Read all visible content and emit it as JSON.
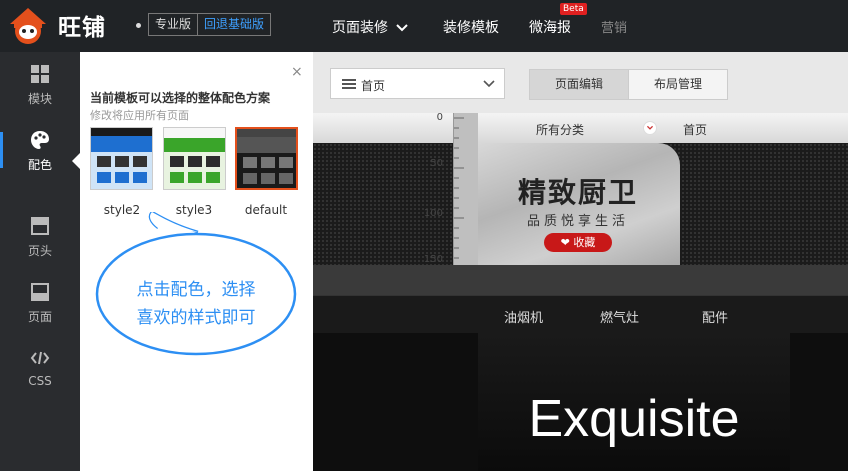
{
  "app": {
    "brand": "旺铺",
    "edition": "专业版",
    "downgrade_link": "回退基础版"
  },
  "topnav": {
    "items": [
      {
        "label": "页面装修",
        "dropdown": true
      },
      {
        "label": "装修模板"
      },
      {
        "label": "微海报",
        "badge": "Beta"
      },
      {
        "label": "营销",
        "muted": true
      }
    ]
  },
  "sidebar": {
    "items": [
      {
        "label": "模块",
        "icon": "grid-icon"
      },
      {
        "label": "配色",
        "icon": "palette-icon",
        "active": true
      },
      {
        "label": "页头",
        "icon": "header-icon"
      },
      {
        "label": "页面",
        "icon": "page-icon"
      },
      {
        "label": "CSS",
        "icon": "code-icon"
      }
    ]
  },
  "color_panel": {
    "title": "当前模板可以选择的整体配色方案",
    "subtitle": "修改将应用所有页面",
    "close": "×",
    "themes": [
      {
        "name": "style2",
        "accent": "#1e6fd0",
        "selected": false
      },
      {
        "name": "style3",
        "accent": "#3aa52a",
        "selected": false
      },
      {
        "name": "default",
        "accent": "#222222",
        "selected": true
      }
    ]
  },
  "hint": {
    "line1": "点击配色，选择",
    "line2": "喜欢的样式即可"
  },
  "editor": {
    "page_select": "首页",
    "tabs": [
      {
        "label": "页面编辑",
        "active": true
      },
      {
        "label": "布局管理",
        "active": false
      }
    ]
  },
  "preview": {
    "category": "所有分类",
    "home": "首页",
    "ruler_marks": [
      "0",
      "50",
      "100",
      "150"
    ],
    "banner_title": "精致厨卫",
    "banner_subtitle": "品质悦享生活",
    "favorite": "收藏",
    "nav": [
      "油烟机",
      "燃气灶",
      "配件"
    ],
    "hero_text": "Exquisite"
  },
  "colors": {
    "accent": "#2d8ff3",
    "selected_border": "#e4501c",
    "topbar": "#202326",
    "sidebar": "#2a2c2f"
  }
}
